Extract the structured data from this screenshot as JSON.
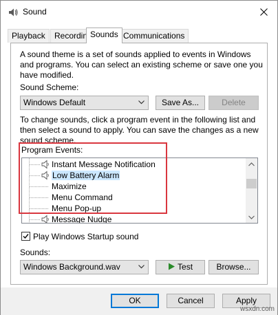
{
  "window": {
    "title": "Sound"
  },
  "tabs": [
    {
      "label": "Playback",
      "active": false
    },
    {
      "label": "Recording",
      "active": false
    },
    {
      "label": "Sounds",
      "active": true
    },
    {
      "label": "Communications",
      "active": false
    }
  ],
  "sounds_tab": {
    "intro_line1": "A sound theme is a set of sounds applied to events in Windows",
    "intro_line2": "and programs.  You can select an existing scheme or save one you",
    "intro_line3": "have modified.",
    "scheme_label": "Sound Scheme:",
    "scheme_value": "Windows Default",
    "save_as_label": "Save As...",
    "delete_label": "Delete",
    "change_line1": "To change sounds, click a program event in the following list and",
    "change_line2": "then select a sound to apply.  You can save the changes as a new",
    "change_line3": "sound scheme.",
    "events_label": "Program Events:",
    "events": [
      {
        "label": "Instant Message Notification",
        "has_sound": true,
        "selected": false
      },
      {
        "label": "Low Battery Alarm",
        "has_sound": true,
        "selected": true
      },
      {
        "label": "Maximize",
        "has_sound": false,
        "selected": false
      },
      {
        "label": "Menu Command",
        "has_sound": false,
        "selected": false
      },
      {
        "label": "Menu Pop-up",
        "has_sound": false,
        "selected": false
      },
      {
        "label": "Message Nudge",
        "has_sound": true,
        "selected": false
      }
    ],
    "startup_checkbox_label": "Play Windows Startup sound",
    "startup_checked": true,
    "sounds_label": "Sounds:",
    "sound_value": "Windows Background.wav",
    "test_label": "Test",
    "browse_label": "Browse..."
  },
  "footer": {
    "ok_label": "OK",
    "cancel_label": "Cancel",
    "apply_label": "Apply"
  },
  "watermark": "wsxdn.com",
  "colors": {
    "highlight_box": "#d9363e",
    "selection": "#cce8ff",
    "accent": "#0078d7"
  }
}
